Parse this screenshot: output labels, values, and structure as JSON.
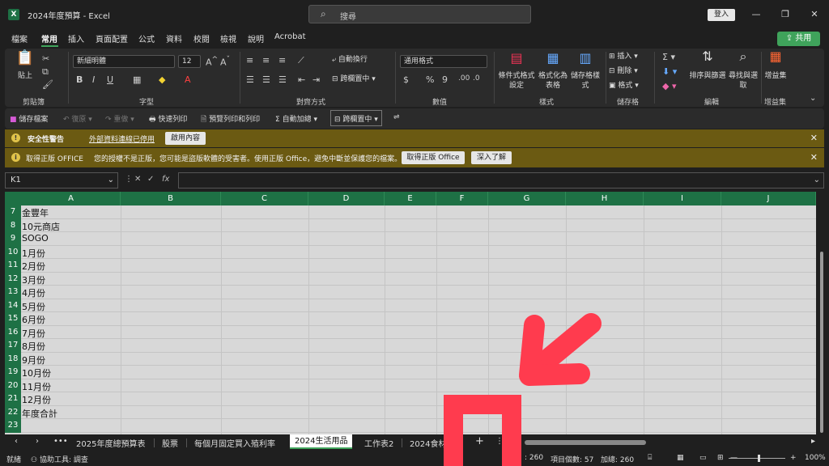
{
  "titlebar": {
    "app_icon": "X",
    "title": "2024年度預算  -  Excel",
    "search_placeholder": "搜尋",
    "search_icon": "search-icon",
    "sign_in": "登入",
    "minimize": "—",
    "restore": "❐",
    "close": "✕"
  },
  "menu": {
    "items": [
      "檔案",
      "常用",
      "插入",
      "頁面配置",
      "公式",
      "資料",
      "校閱",
      "檢視",
      "說明",
      "Acrobat"
    ],
    "active_index": 1,
    "share": "共用"
  },
  "ribbon": {
    "clipboard": {
      "paste": "貼上",
      "label": "剪貼簿"
    },
    "font": {
      "name": "新細明體",
      "size": "12",
      "label": "字型",
      "bold": "B",
      "italic": "I",
      "underline": "U"
    },
    "alignment": {
      "wrap": "自動換行",
      "merge": "跨欄置中",
      "label": "對齊方式"
    },
    "number": {
      "format": "通用格式",
      "currency": "$",
      "percent": "%",
      "comma": "9",
      "label": "數值"
    },
    "styles": {
      "conditional": "條件式格式設定",
      "table": "格式化為表格",
      "cell": "儲存格樣式",
      "label": "樣式"
    },
    "cells": {
      "insert": "插入",
      "delete": "刪除",
      "format": "格式",
      "label": "儲存格"
    },
    "editing": {
      "sort": "排序與篩選",
      "find": "尋找與選取",
      "label": "編輯"
    },
    "addins": {
      "label": "增益集",
      "btn": "增益集"
    }
  },
  "qat": {
    "save": "儲存檔案",
    "undo": "復原",
    "redo": "重做",
    "quick_print": "快速列印",
    "preview": "預覽列印和列印",
    "autosum": "自動加總",
    "merge": "跨欄置中"
  },
  "security_bar": {
    "title": "安全性警告",
    "link": "外部資料連線已停用",
    "button": "啟用內容"
  },
  "license_bar": {
    "title": "取得正版 OFFICE",
    "message": "您的授權不是正版，您可能是盜版軟體的受害者。使用正版 Office，避免中斷並保護您的檔案。",
    "button1": "取得正版 Office",
    "button2": "深入了解"
  },
  "formula_bar": {
    "name_box": "K1",
    "fx": "fx",
    "value": ""
  },
  "columns": [
    "A",
    "B",
    "C",
    "D",
    "E",
    "F",
    "G",
    "H",
    "I",
    "J"
  ],
  "rows": [
    {
      "num": "7",
      "a": "金豐年"
    },
    {
      "num": "8",
      "a": "10元商店"
    },
    {
      "num": "9",
      "a": "SOGO"
    },
    {
      "num": "10",
      "a": "1月份"
    },
    {
      "num": "11",
      "a": "2月份"
    },
    {
      "num": "12",
      "a": "3月份"
    },
    {
      "num": "13",
      "a": "4月份"
    },
    {
      "num": "14",
      "a": "5月份"
    },
    {
      "num": "15",
      "a": "6月份"
    },
    {
      "num": "16",
      "a": "7月份"
    },
    {
      "num": "17",
      "a": "8月份"
    },
    {
      "num": "18",
      "a": "9月份"
    },
    {
      "num": "19",
      "a": "10月份"
    },
    {
      "num": "20",
      "a": "11月份"
    },
    {
      "num": "21",
      "a": "12月份"
    },
    {
      "num": "22",
      "a": "年度合計"
    },
    {
      "num": "23",
      "a": ""
    }
  ],
  "sheets": {
    "tabs": [
      "2025年度總預算表",
      "股票",
      "每個月固定買入殖利率",
      "2024生活用品",
      "工作表2",
      "2024食材"
    ],
    "active_index": 3,
    "more": "•••",
    "add": "+"
  },
  "status": {
    "ready": "就緒",
    "accessibility": "協助工具: 調查",
    "count_label": "項目個數: 57",
    "sum_label": "加總: 260",
    "sum_partial": ": 260",
    "zoom": "100%"
  },
  "overlay": {
    "color": "#ff3b4e"
  }
}
